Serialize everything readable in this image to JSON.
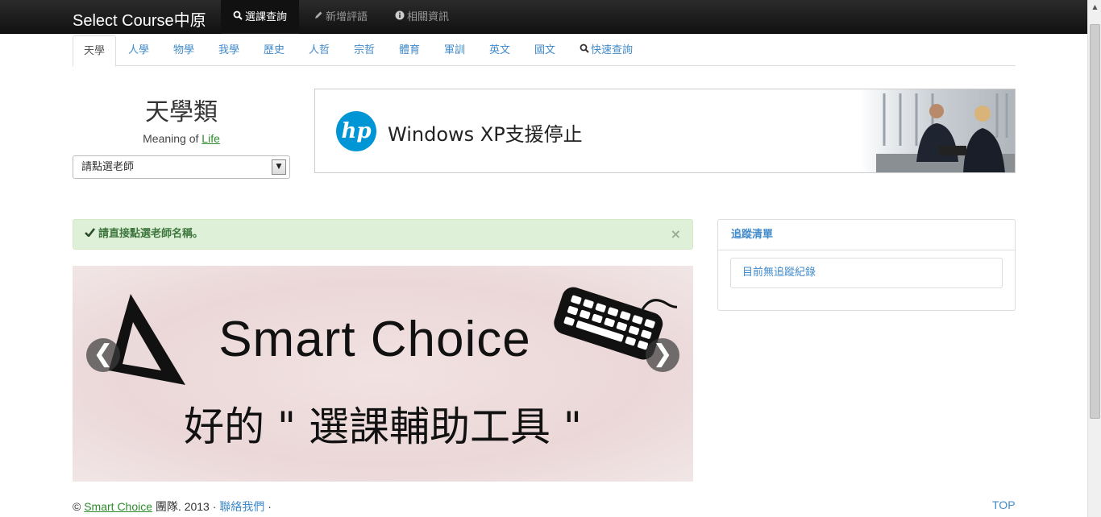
{
  "navbar": {
    "brand": "Select Course中原",
    "items": [
      {
        "label": "選課查詢",
        "icon": "search-icon",
        "active": true
      },
      {
        "label": "新增評語",
        "icon": "pencil-icon",
        "active": false
      },
      {
        "label": "相關資訊",
        "icon": "info-icon",
        "active": false
      }
    ]
  },
  "tabs": [
    {
      "label": "天學",
      "active": true
    },
    {
      "label": "人學"
    },
    {
      "label": "物學"
    },
    {
      "label": "我學"
    },
    {
      "label": "歷史"
    },
    {
      "label": "人哲"
    },
    {
      "label": "宗哲"
    },
    {
      "label": "體育"
    },
    {
      "label": "軍訓"
    },
    {
      "label": "英文"
    },
    {
      "label": "國文"
    },
    {
      "label": "快速查詢",
      "icon": "search-icon"
    }
  ],
  "category": {
    "title": "天學類",
    "subtitle_prefix": "Meaning of ",
    "subtitle_link": "Life",
    "select_value": "請點選老師"
  },
  "ad": {
    "logo": "hp",
    "text": "Windows XP支援停止"
  },
  "alert": {
    "text": "請直接點選老師名稱。",
    "close": "×"
  },
  "carousel": {
    "title": "Smart Choice",
    "subtitle": "好的 \" 選課輔助工具 \"",
    "prev": "❮",
    "next": "❯"
  },
  "tracking": {
    "title": "追蹤清單",
    "empty_text": "目前無追蹤紀錄"
  },
  "footer": {
    "copyright": "©",
    "brand_link": "Smart Choice",
    "team_year": "團隊. 2013 ·",
    "contact": "聯絡我們",
    "sep": "·",
    "top": "TOP"
  },
  "colors": {
    "navbar_bg": "#1b1b1b",
    "link": "#428bca",
    "alert_bg": "#dff0d8",
    "alert_text": "#3c763d",
    "hp_blue": "#0096d6"
  }
}
